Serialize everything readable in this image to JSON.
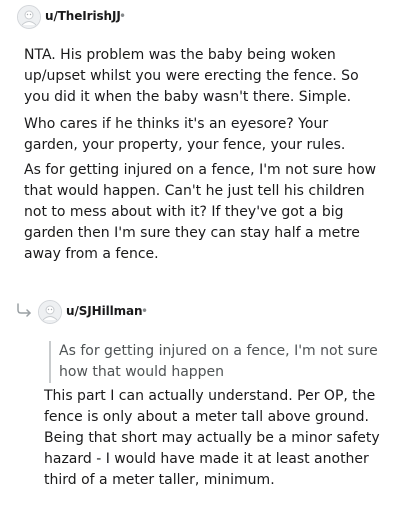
{
  "comment1": {
    "username": "u/TheIrishJJ",
    "separator": "•",
    "paragraphs": [
      "NTA. His problem was the baby being woken up/upset whilst you were erecting the fence. So you did it when the baby wasn't there. Simple.",
      "Who cares if he thinks it's an eyesore? Your garden, your property, your fence, your rules.",
      "As for getting injured on a fence, I'm not sure how that would happen. Can't he just tell his children not to mess about with it? If they've got a big garden then I'm sure they can stay half a metre away from a fence."
    ]
  },
  "comment2": {
    "username": "u/SJHillman",
    "separator": "•",
    "quote": "As for getting injured on a fence, I'm not sure how that would happen",
    "body": "This part I can actually understand. Per OP, the fence is only about a meter tall above ground. Being that short may actually be a minor safety hazard - I would have made it at least another third of a meter taller, minimum."
  },
  "icons": {
    "avatar": "default-avatar-icon",
    "reply": "reply-arrow-icon"
  },
  "colors": {
    "text": "#1a1a1b",
    "muted": "#878a8c",
    "quote_bar": "#c8cbcd"
  }
}
